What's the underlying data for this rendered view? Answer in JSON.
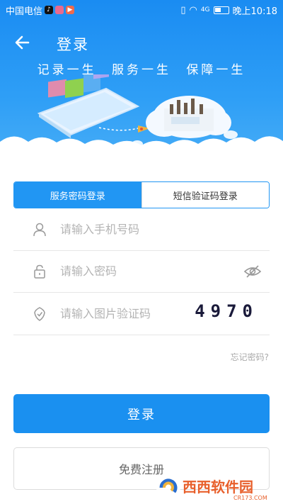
{
  "status_bar": {
    "carrier": "中国电信",
    "time": "晚上10:18",
    "network": "4G"
  },
  "header": {
    "title": "登录",
    "slogan": [
      "记录一生",
      "服务一生",
      "保障一生"
    ]
  },
  "tabs": [
    {
      "label": "服务密码登录",
      "active": true
    },
    {
      "label": "短信验证码登录",
      "active": false
    }
  ],
  "form": {
    "phone_placeholder": "请输入手机号码",
    "password_placeholder": "请输入密码",
    "captcha_placeholder": "请输入图片验证码",
    "captcha_code": "4970"
  },
  "forgot_password": "忘记密码?",
  "login_label": "登录",
  "register_label": "免费注册",
  "watermark": {
    "text": "西西软件园",
    "sub": "CR173.COM"
  },
  "colors": {
    "primary": "#1a90f0",
    "header": "#2196f3"
  }
}
